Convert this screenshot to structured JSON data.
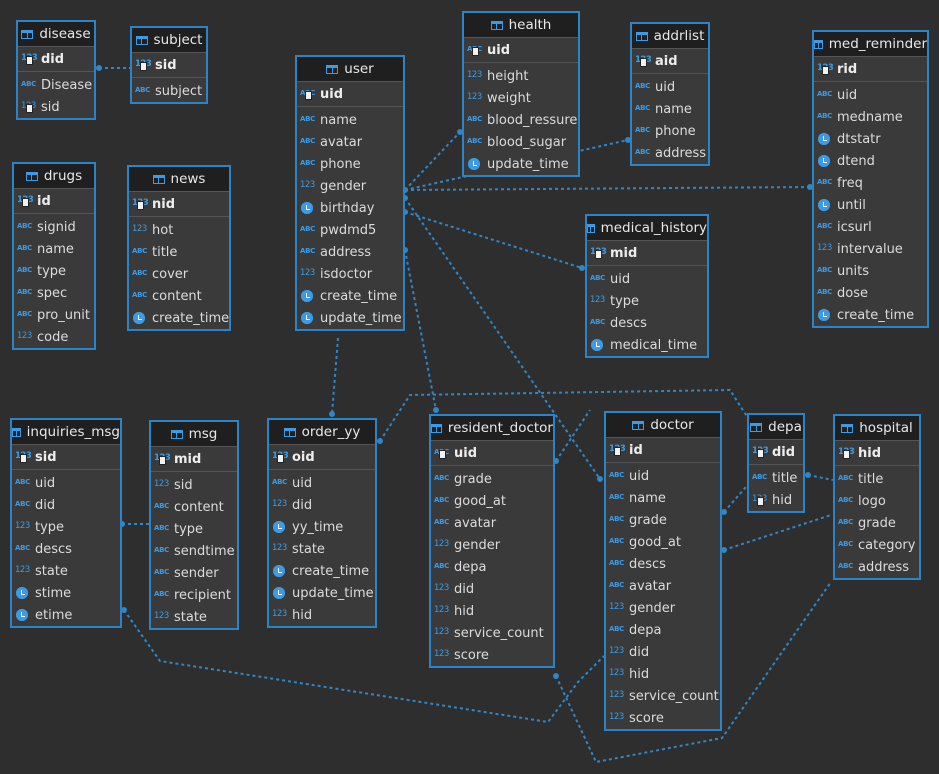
{
  "tables": [
    {
      "id": "disease",
      "name": "disease",
      "pk": {
        "name": "did",
        "type": "num"
      },
      "columns": [
        {
          "name": "Disease",
          "type": "abc"
        },
        {
          "name": "sid",
          "type": "num",
          "key": true
        }
      ]
    },
    {
      "id": "subject",
      "name": "subject",
      "pk": {
        "name": "sid",
        "type": "num"
      },
      "columns": [
        {
          "name": "subject",
          "type": "abc"
        }
      ]
    },
    {
      "id": "drugs",
      "name": "drugs",
      "pk": {
        "name": "id",
        "type": "num"
      },
      "columns": [
        {
          "name": "signid",
          "type": "abc"
        },
        {
          "name": "name",
          "type": "abc"
        },
        {
          "name": "type",
          "type": "abc"
        },
        {
          "name": "spec",
          "type": "abc"
        },
        {
          "name": "pro_unit",
          "type": "abc"
        },
        {
          "name": "code",
          "type": "num"
        }
      ]
    },
    {
      "id": "news",
      "name": "news",
      "pk": {
        "name": "nid",
        "type": "num"
      },
      "columns": [
        {
          "name": "hot",
          "type": "num"
        },
        {
          "name": "title",
          "type": "abc"
        },
        {
          "name": "cover",
          "type": "abc"
        },
        {
          "name": "content",
          "type": "abc"
        },
        {
          "name": "create_time",
          "type": "time"
        }
      ]
    },
    {
      "id": "user",
      "name": "user",
      "pk": {
        "name": "uid",
        "type": "abc"
      },
      "columns": [
        {
          "name": "name",
          "type": "abc"
        },
        {
          "name": "avatar",
          "type": "abc"
        },
        {
          "name": "phone",
          "type": "abc"
        },
        {
          "name": "gender",
          "type": "num"
        },
        {
          "name": "birthday",
          "type": "time"
        },
        {
          "name": "pwdmd5",
          "type": "abc"
        },
        {
          "name": "address",
          "type": "abc"
        },
        {
          "name": "isdoctor",
          "type": "num"
        },
        {
          "name": "create_time",
          "type": "time"
        },
        {
          "name": "update_time",
          "type": "time"
        }
      ]
    },
    {
      "id": "health",
      "name": "health",
      "pk": {
        "name": "uid",
        "type": "abc"
      },
      "columns": [
        {
          "name": "height",
          "type": "num"
        },
        {
          "name": "weight",
          "type": "num"
        },
        {
          "name": "blood_ressure",
          "type": "abc"
        },
        {
          "name": "blood_sugar",
          "type": "abc"
        },
        {
          "name": "update_time",
          "type": "time"
        }
      ]
    },
    {
      "id": "addrlist",
      "name": "addrlist",
      "pk": {
        "name": "aid",
        "type": "num"
      },
      "columns": [
        {
          "name": "uid",
          "type": "abc"
        },
        {
          "name": "name",
          "type": "abc"
        },
        {
          "name": "phone",
          "type": "abc"
        },
        {
          "name": "address",
          "type": "abc"
        }
      ]
    },
    {
      "id": "med_reminder",
      "name": "med_reminder",
      "pk": {
        "name": "rid",
        "type": "num"
      },
      "columns": [
        {
          "name": "uid",
          "type": "abc"
        },
        {
          "name": "medname",
          "type": "abc"
        },
        {
          "name": "dtstatr",
          "type": "time"
        },
        {
          "name": "dtend",
          "type": "time"
        },
        {
          "name": "freq",
          "type": "abc"
        },
        {
          "name": "until",
          "type": "time"
        },
        {
          "name": "icsurl",
          "type": "abc"
        },
        {
          "name": "intervalue",
          "type": "num"
        },
        {
          "name": "units",
          "type": "abc"
        },
        {
          "name": "dose",
          "type": "abc"
        },
        {
          "name": "create_time",
          "type": "time"
        }
      ]
    },
    {
      "id": "medical_history",
      "name": "medical_history",
      "pk": {
        "name": "mid",
        "type": "num"
      },
      "columns": [
        {
          "name": "uid",
          "type": "abc"
        },
        {
          "name": "type",
          "type": "num"
        },
        {
          "name": "descs",
          "type": "abc"
        },
        {
          "name": "medical_time",
          "type": "time"
        }
      ]
    },
    {
      "id": "inquiries_msg",
      "name": "inquiries_msg",
      "pk": {
        "name": "sid",
        "type": "num"
      },
      "columns": [
        {
          "name": "uid",
          "type": "abc"
        },
        {
          "name": "did",
          "type": "abc"
        },
        {
          "name": "type",
          "type": "num"
        },
        {
          "name": "descs",
          "type": "abc"
        },
        {
          "name": "state",
          "type": "num"
        },
        {
          "name": "stime",
          "type": "time"
        },
        {
          "name": "etime",
          "type": "time"
        }
      ]
    },
    {
      "id": "msg",
      "name": "msg",
      "pk": {
        "name": "mid",
        "type": "num"
      },
      "columns": [
        {
          "name": "sid",
          "type": "num"
        },
        {
          "name": "content",
          "type": "abc"
        },
        {
          "name": "type",
          "type": "abc"
        },
        {
          "name": "sendtime",
          "type": "abc"
        },
        {
          "name": "sender",
          "type": "abc"
        },
        {
          "name": "recipient",
          "type": "abc"
        },
        {
          "name": "state",
          "type": "num"
        }
      ]
    },
    {
      "id": "order_yy",
      "name": "order_yy",
      "pk": {
        "name": "oid",
        "type": "num"
      },
      "columns": [
        {
          "name": "uid",
          "type": "abc"
        },
        {
          "name": "did",
          "type": "num"
        },
        {
          "name": "yy_time",
          "type": "time"
        },
        {
          "name": "state",
          "type": "num"
        },
        {
          "name": "create_time",
          "type": "time"
        },
        {
          "name": "update_time",
          "type": "time"
        },
        {
          "name": "hid",
          "type": "num"
        }
      ]
    },
    {
      "id": "resident_doctor",
      "name": "resident_doctor",
      "pk": {
        "name": "uid",
        "type": "abc"
      },
      "columns": [
        {
          "name": "grade",
          "type": "abc"
        },
        {
          "name": "good_at",
          "type": "abc"
        },
        {
          "name": "avatar",
          "type": "abc"
        },
        {
          "name": "gender",
          "type": "num"
        },
        {
          "name": "depa",
          "type": "abc"
        },
        {
          "name": "did",
          "type": "num"
        },
        {
          "name": "hid",
          "type": "num"
        },
        {
          "name": "service_count",
          "type": "num"
        },
        {
          "name": "score",
          "type": "num"
        }
      ]
    },
    {
      "id": "doctor",
      "name": "doctor",
      "pk": {
        "name": "id",
        "type": "num"
      },
      "columns": [
        {
          "name": "uid",
          "type": "abc"
        },
        {
          "name": "name",
          "type": "abc"
        },
        {
          "name": "grade",
          "type": "abc"
        },
        {
          "name": "good_at",
          "type": "abc"
        },
        {
          "name": "descs",
          "type": "abc"
        },
        {
          "name": "avatar",
          "type": "abc"
        },
        {
          "name": "gender",
          "type": "num"
        },
        {
          "name": "depa",
          "type": "abc"
        },
        {
          "name": "did",
          "type": "num"
        },
        {
          "name": "hid",
          "type": "num"
        },
        {
          "name": "service_count",
          "type": "num"
        },
        {
          "name": "score",
          "type": "num"
        }
      ]
    },
    {
      "id": "depa",
      "name": "depa",
      "pk": {
        "name": "did",
        "type": "num"
      },
      "columns": [
        {
          "name": "title",
          "type": "abc"
        },
        {
          "name": "hid",
          "type": "num",
          "key": true
        }
      ]
    },
    {
      "id": "hospital",
      "name": "hospital",
      "pk": {
        "name": "hid",
        "type": "num"
      },
      "columns": [
        {
          "name": "title",
          "type": "abc"
        },
        {
          "name": "logo",
          "type": "abc"
        },
        {
          "name": "grade",
          "type": "abc"
        },
        {
          "name": "category",
          "type": "abc"
        },
        {
          "name": "address",
          "type": "abc"
        }
      ]
    }
  ],
  "style": {
    "border": "#2c83c6",
    "link": "#2f86c8",
    "background": "#2e2e2e"
  }
}
